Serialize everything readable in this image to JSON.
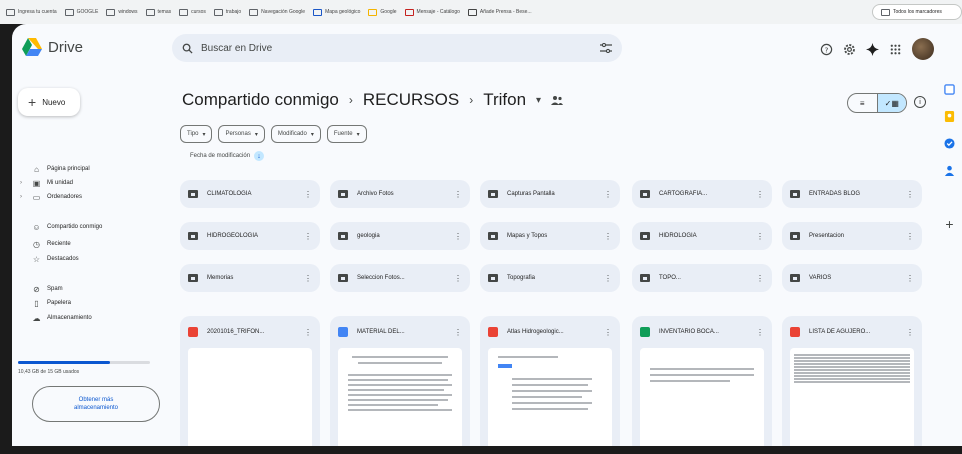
{
  "bookmarks": [
    {
      "label": "Ingresa tu cuenta",
      "color": "#5f6368"
    },
    {
      "label": "GOOGLE",
      "color": "#5f6368"
    },
    {
      "label": "windows",
      "color": "#5f6368"
    },
    {
      "label": "temas",
      "color": "#5f6368"
    },
    {
      "label": "cursos",
      "color": "#5f6368"
    },
    {
      "label": "trabajo",
      "color": "#5f6368"
    },
    {
      "label": "Navegación Google",
      "color": "#5f6368"
    },
    {
      "label": "Mapa geológico",
      "color": "#1a56c7"
    },
    {
      "label": "Google",
      "color": "#f4b400"
    },
    {
      "label": "Mensaje - Catálogo",
      "color": "#c5221f"
    },
    {
      "label": "Añade Prensa - Bese...",
      "color": "#444"
    }
  ],
  "bookmarks_right": "Todos los marcadores",
  "app": {
    "name": "Drive"
  },
  "search": {
    "placeholder": "Buscar en Drive"
  },
  "sidebar": {
    "new_label": "Nuevo",
    "items": [
      {
        "label": "Página principal",
        "icon": "home-icon",
        "chev": false
      },
      {
        "label": "Mi unidad",
        "icon": "my-drive-icon",
        "chev": true
      },
      {
        "label": "Ordenadores",
        "icon": "computer-icon",
        "chev": true
      },
      {
        "label": "Compartido conmigo",
        "icon": "shared-icon",
        "chev": false
      },
      {
        "label": "Reciente",
        "icon": "recent-icon",
        "chev": false
      },
      {
        "label": "Destacados",
        "icon": "star-icon",
        "chev": false
      },
      {
        "label": "Spam",
        "icon": "spam-icon",
        "chev": false
      },
      {
        "label": "Papelera",
        "icon": "trash-icon",
        "chev": false
      },
      {
        "label": "Almacenamiento",
        "icon": "cloud-icon",
        "chev": false
      }
    ],
    "storage_text": "10,43 GB de 15 GB usados",
    "storage_fraction": 0.7,
    "get_storage_line1": "Obtener más",
    "get_storage_line2": "almacenamiento"
  },
  "breadcrumb": {
    "root": "Compartido conmigo",
    "level1": "RECURSOS",
    "current": "Trifon"
  },
  "filters": [
    "Tipo",
    "Personas",
    "Modificado",
    "Fuente"
  ],
  "sort_label": "Fecha de modificación",
  "folders": [
    "CLIMATOLOGIA",
    "Archivo Fotos",
    "Capturas Pantalla",
    "CARTOGRAFIA...",
    "ENTRADAS BLOG",
    "HIDROGEOLOGIA",
    "geologia",
    "Mapas y Topos",
    "HIDROLOGIA",
    "Presentacion",
    "Memorias",
    "Seleccion Fotos...",
    "Topografia",
    "TOPO...",
    "VARIOS"
  ],
  "files": [
    {
      "name": "20201016_TRIFON...",
      "type_color": "#ea4335",
      "type_letter": ""
    },
    {
      "name": "MATERIAL DEL...",
      "type_color": "#4285f4",
      "type_letter": ""
    },
    {
      "name": "Atlas Hidrogeologic...",
      "type_color": "#ea4335",
      "type_letter": ""
    },
    {
      "name": "INVENTARIO BOCA...",
      "type_color": "#0f9d58",
      "type_letter": ""
    },
    {
      "name": "LISTA DE AGUJERO...",
      "type_color": "#ea4335",
      "type_letter": ""
    }
  ],
  "colors": {
    "accent": "#0b57d0",
    "surface": "#e9eef6",
    "toggle_on": "#c2e7ff"
  }
}
